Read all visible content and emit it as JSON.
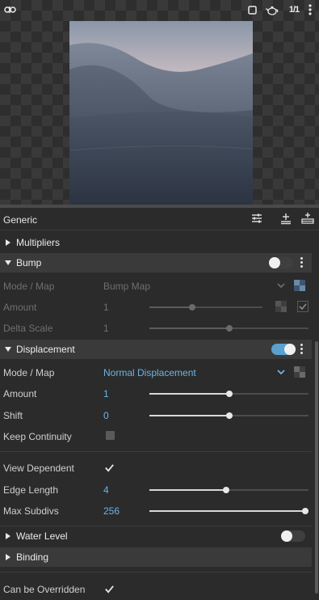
{
  "viewport": {
    "icons": [
      "link-icon",
      "frame-icon",
      "teapot-icon",
      "ratio-icon",
      "more-icon"
    ],
    "ratio_label": "1/1"
  },
  "panel": {
    "title": "Generic",
    "sections": {
      "multipliers": {
        "label": "Multipliers"
      },
      "bump": {
        "label": "Bump",
        "enabled": false,
        "mode_label": "Mode / Map",
        "mode_value": "Bump Map",
        "amount_label": "Amount",
        "amount_value": "1",
        "amount_fraction": 0.38,
        "amount_checked": true,
        "delta_label": "Delta Scale",
        "delta_value": "1",
        "delta_fraction": 0.5
      },
      "displacement": {
        "label": "Displacement",
        "enabled": true,
        "mode_label": "Mode / Map",
        "mode_value": "Normal Displacement",
        "amount_label": "Amount",
        "amount_value": "1",
        "amount_fraction": 0.5,
        "shift_label": "Shift",
        "shift_value": "0",
        "shift_fraction": 0.5,
        "keep_label": "Keep Continuity",
        "keep_checked": false,
        "view_label": "View Dependent",
        "view_checked": true,
        "edge_label": "Edge Length",
        "edge_value": "4",
        "edge_fraction": 0.48,
        "subdivs_label": "Max Subdivs",
        "subdivs_value": "256",
        "subdivs_fraction": 1.0
      },
      "water": {
        "label": "Water Level",
        "enabled": false
      },
      "binding": {
        "label": "Binding"
      },
      "override": {
        "label": "Can be Overridden",
        "checked": true
      }
    }
  },
  "colors": {
    "accent": "#6cb3e6",
    "toggle_on": "#5aa0d0"
  }
}
